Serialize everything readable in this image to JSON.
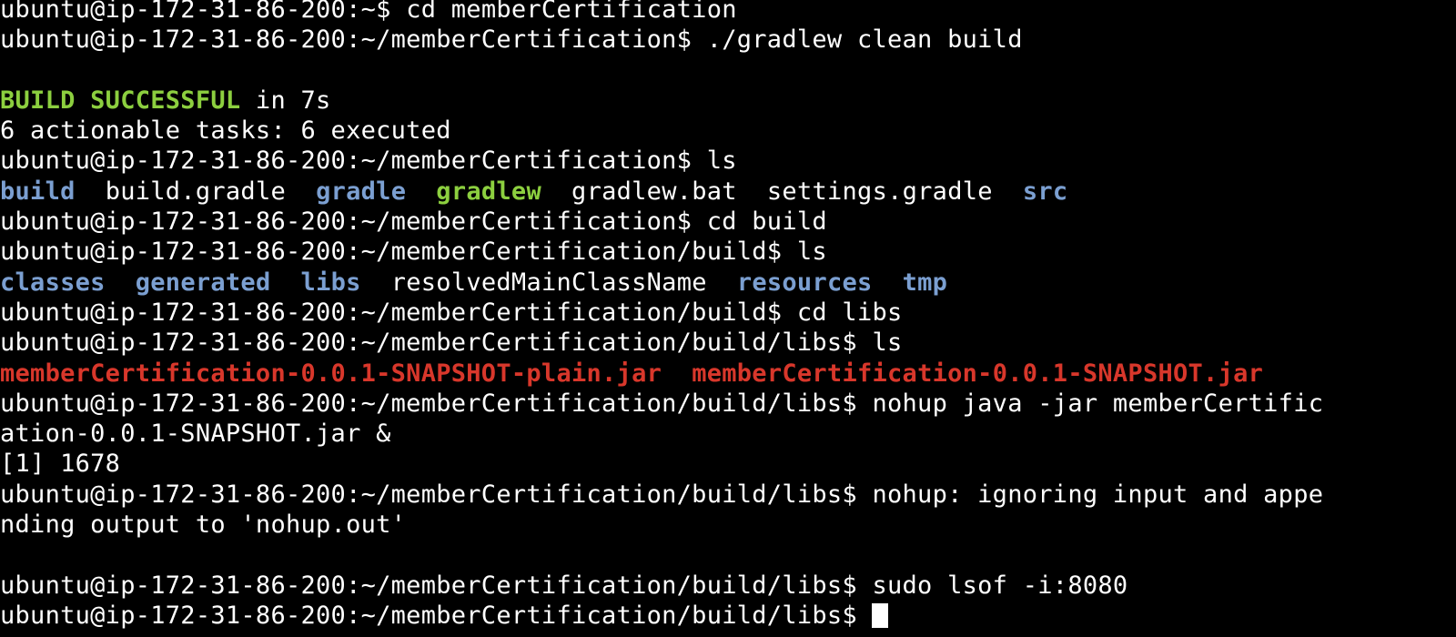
{
  "terminal": {
    "title": "ubuntu@ip-172-31-86-200: ~/memberCertification/build/libs",
    "background_color": "#000000",
    "foreground_color": "#ffffff",
    "colors": {
      "default": "#ffffff",
      "directory": "#7b9fd1",
      "executable": "#8ccf3f",
      "archive": "#d8372b",
      "success": "#8ccf3f",
      "cursor": "#ffffff"
    },
    "user": "ubuntu",
    "host": "ip-172-31-86-200",
    "prompts": {
      "home": "ubuntu@ip-172-31-86-200:~$ ",
      "project": "ubuntu@ip-172-31-86-200:~/memberCertification$ ",
      "build": "ubuntu@ip-172-31-86-200:~/memberCertification/build$ ",
      "libs": "ubuntu@ip-172-31-86-200:~/memberCertification/build/libs$ "
    },
    "rows": [
      {
        "id": "row-cd-membercertification",
        "kind": "command",
        "segments": [
          {
            "text": "ubuntu@ip-172-31-86-200:~$ ",
            "color": "default"
          },
          {
            "text": "cd memberCertification",
            "color": "default"
          }
        ]
      },
      {
        "id": "row-gradlew-clean-build",
        "kind": "command",
        "segments": [
          {
            "text": "ubuntu@ip-172-31-86-200:~/memberCertification$ ",
            "color": "default"
          },
          {
            "text": "./gradlew clean build",
            "color": "default"
          }
        ]
      },
      {
        "id": "row-blank-1",
        "kind": "blank",
        "segments": []
      },
      {
        "id": "row-build-successful",
        "kind": "output",
        "segments": [
          {
            "text": "BUILD SUCCESSFUL",
            "color": "success"
          },
          {
            "text": " in 7s",
            "color": "default"
          }
        ]
      },
      {
        "id": "row-actionable-tasks",
        "kind": "output",
        "segments": [
          {
            "text": "6 actionable tasks: 6 executed",
            "color": "default"
          }
        ]
      },
      {
        "id": "row-ls-project",
        "kind": "command",
        "segments": [
          {
            "text": "ubuntu@ip-172-31-86-200:~/memberCertification$ ",
            "color": "default"
          },
          {
            "text": "ls",
            "color": "default"
          }
        ]
      },
      {
        "id": "row-ls-project-output",
        "kind": "output",
        "segments": [
          {
            "text": "build",
            "color": "directory"
          },
          {
            "text": "  ",
            "color": "default"
          },
          {
            "text": "build.gradle",
            "color": "default"
          },
          {
            "text": "  ",
            "color": "default"
          },
          {
            "text": "gradle",
            "color": "directory"
          },
          {
            "text": "  ",
            "color": "default"
          },
          {
            "text": "gradlew",
            "color": "executable"
          },
          {
            "text": "  ",
            "color": "default"
          },
          {
            "text": "gradlew.bat",
            "color": "default"
          },
          {
            "text": "  ",
            "color": "default"
          },
          {
            "text": "settings.gradle",
            "color": "default"
          },
          {
            "text": "  ",
            "color": "default"
          },
          {
            "text": "src",
            "color": "directory"
          }
        ]
      },
      {
        "id": "row-cd-build",
        "kind": "command",
        "segments": [
          {
            "text": "ubuntu@ip-172-31-86-200:~/memberCertification$ ",
            "color": "default"
          },
          {
            "text": "cd build",
            "color": "default"
          }
        ]
      },
      {
        "id": "row-ls-build",
        "kind": "command",
        "segments": [
          {
            "text": "ubuntu@ip-172-31-86-200:~/memberCertification/build$ ",
            "color": "default"
          },
          {
            "text": "ls",
            "color": "default"
          }
        ]
      },
      {
        "id": "row-ls-build-output",
        "kind": "output",
        "segments": [
          {
            "text": "classes",
            "color": "directory"
          },
          {
            "text": "  ",
            "color": "default"
          },
          {
            "text": "generated",
            "color": "directory"
          },
          {
            "text": "  ",
            "color": "default"
          },
          {
            "text": "libs",
            "color": "directory"
          },
          {
            "text": "  ",
            "color": "default"
          },
          {
            "text": "resolvedMainClassName",
            "color": "default"
          },
          {
            "text": "  ",
            "color": "default"
          },
          {
            "text": "resources",
            "color": "directory"
          },
          {
            "text": "  ",
            "color": "default"
          },
          {
            "text": "tmp",
            "color": "directory"
          }
        ]
      },
      {
        "id": "row-cd-libs",
        "kind": "command",
        "segments": [
          {
            "text": "ubuntu@ip-172-31-86-200:~/memberCertification/build$ ",
            "color": "default"
          },
          {
            "text": "cd libs",
            "color": "default"
          }
        ]
      },
      {
        "id": "row-ls-libs",
        "kind": "command",
        "segments": [
          {
            "text": "ubuntu@ip-172-31-86-200:~/memberCertification/build/libs$ ",
            "color": "default"
          },
          {
            "text": "ls",
            "color": "default"
          }
        ]
      },
      {
        "id": "row-ls-libs-output",
        "kind": "output",
        "segments": [
          {
            "text": "memberCertification-0.0.1-SNAPSHOT-plain.jar",
            "color": "archive"
          },
          {
            "text": "  ",
            "color": "default"
          },
          {
            "text": "memberCertification-0.0.1-SNAPSHOT.jar",
            "color": "archive"
          }
        ]
      },
      {
        "id": "row-nohup-java-jar-part1",
        "kind": "command",
        "segments": [
          {
            "text": "ubuntu@ip-172-31-86-200:~/memberCertification/build/libs$ ",
            "color": "default"
          },
          {
            "text": "nohup java -jar memberCertific",
            "color": "default"
          }
        ]
      },
      {
        "id": "row-nohup-java-jar-part2",
        "kind": "command-wrap",
        "segments": [
          {
            "text": "ation-0.0.1-SNAPSHOT.jar &",
            "color": "default"
          }
        ]
      },
      {
        "id": "row-job-id",
        "kind": "output",
        "segments": [
          {
            "text": "[1] 1678",
            "color": "default"
          }
        ]
      },
      {
        "id": "row-nohup-notice-part1",
        "kind": "output",
        "segments": [
          {
            "text": "ubuntu@ip-172-31-86-200:~/memberCertification/build/libs$ ",
            "color": "default"
          },
          {
            "text": "nohup: ignoring input and appe",
            "color": "default"
          }
        ]
      },
      {
        "id": "row-nohup-notice-part2",
        "kind": "output-wrap",
        "segments": [
          {
            "text": "nding output to 'nohup.out'",
            "color": "default"
          }
        ]
      },
      {
        "id": "row-blank-2",
        "kind": "blank",
        "segments": []
      },
      {
        "id": "row-sudo-lsof",
        "kind": "command",
        "segments": [
          {
            "text": "ubuntu@ip-172-31-86-200:~/memberCertification/build/libs$ ",
            "color": "default"
          },
          {
            "text": "sudo lsof -i:8080",
            "color": "default"
          }
        ]
      },
      {
        "id": "row-active-prompt",
        "kind": "prompt",
        "has_cursor": true,
        "segments": [
          {
            "text": "ubuntu@ip-172-31-86-200:~/memberCertification/build/libs$ ",
            "color": "default"
          }
        ]
      }
    ]
  }
}
